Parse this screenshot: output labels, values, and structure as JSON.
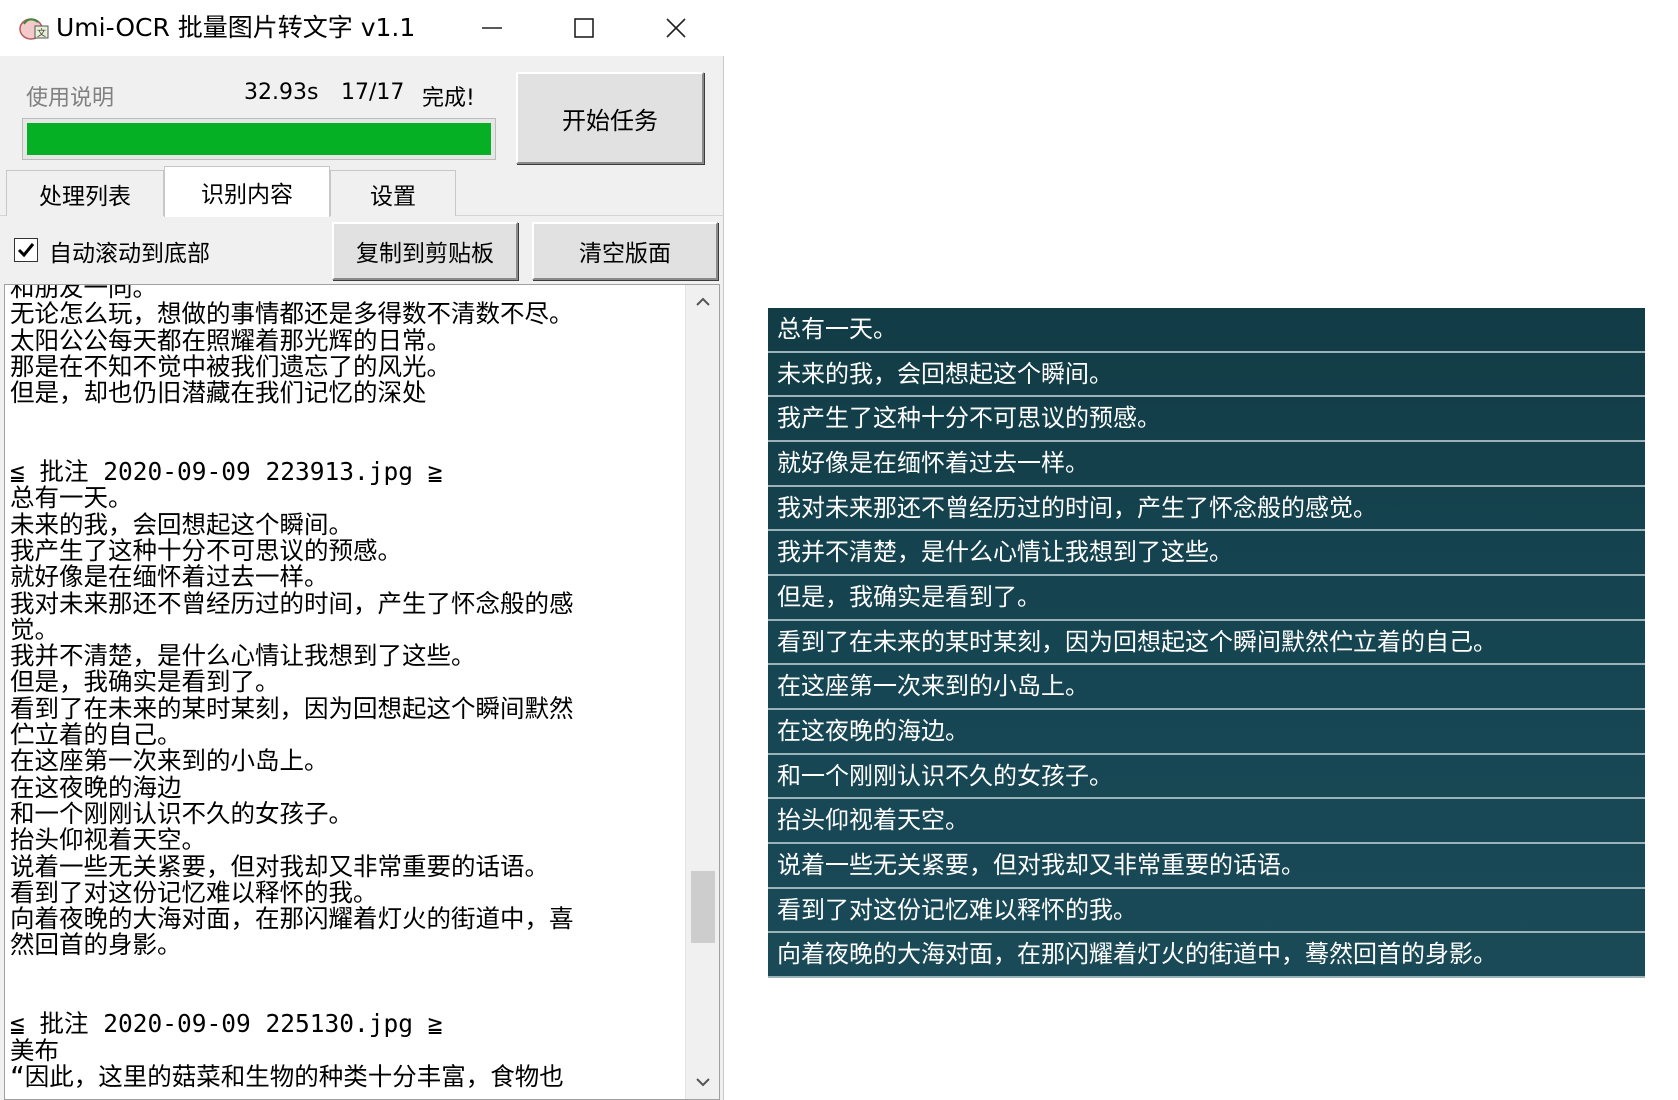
{
  "window": {
    "title": "Umi-OCR 批量图片转文字 v1.1",
    "controls": {
      "minimize": "—",
      "maximize": "☐",
      "close": "✕"
    }
  },
  "status": {
    "help_label": "使用说明",
    "elapsed": "32.93s",
    "count": "17/17",
    "state": "完成!",
    "progress": 1.0,
    "progress_color": "#06b025"
  },
  "start_button": "开始任务",
  "tabs": [
    {
      "label": "处理列表",
      "active": false
    },
    {
      "label": "识别内容",
      "active": true
    },
    {
      "label": "设置",
      "active": false
    }
  ],
  "toolbar": {
    "auto_scroll_label": "自动滚动到底部",
    "auto_scroll_checked": true,
    "copy_label": "复制到剪贴板",
    "clear_label": "清空版面"
  },
  "output_lines": [
    "和朋友一同。",
    "无论怎么玩，想做的事情都还是多得数不清数不尽。",
    "太阳公公每天都在照耀着那光辉的日常。",
    "那是在不知不觉中被我们遗忘了的风光。",
    "但是，却也仍旧潜藏在我们记忆的深处",
    "",
    "",
    "≦ 批注 2020-09-09 223913.jpg ≧",
    "总有一天。",
    "未来的我，会回想起这个瞬间。",
    "我产生了这种十分不可思议的预感。",
    "就好像是在缅怀着过去一样。",
    "我对未来那还不曾经历过的时间，产生了怀念般的感",
    "觉。",
    "我并不清楚，是什么心情让我想到了这些。",
    "但是，我确实是看到了。",
    "看到了在未来的某时某刻，因为回想起这个瞬间默然",
    "伫立着的自己。",
    "在这座第一次来到的小岛上。",
    "在这夜晚的海边",
    "和一个刚刚认识不久的女孩子。",
    "抬头仰视着天空。",
    "说着一些无关紧要，但对我却又非常重要的话语。",
    "看到了对这份记忆难以释怀的我。",
    "向着夜晚的大海对面，在那闪耀着灯火的街道中，喜",
    "然回首的身影。",
    "",
    "",
    "≦ 批注 2020-09-09 225130.jpg ≧",
    "美布",
    "“因此，这里的菇菜和生物的种类十分丰富，食物也"
  ],
  "game_subtitles": [
    "总有一天。",
    "未来的我，会回想起这个瞬间。",
    "我产生了这种十分不可思议的预感。",
    "就好像是在缅怀着过去一样。",
    "我对未来那还不曾经历过的时间，产生了怀念般的感觉。",
    "我并不清楚，是什么心情让我想到了这些。",
    "但是，我确实是看到了。",
    "看到了在未来的某时某刻，因为回想起这个瞬间默然伫立着的自己。",
    "在这座第一次来到的小岛上。",
    "在这夜晚的海边。",
    "和一个刚刚认识不久的女孩子。",
    "抬头仰视着天空。",
    "说着一些无关紧要，但对我却又非常重要的话语。",
    "看到了对这份记忆难以释怀的我。",
    "向着夜晚的大海对面，在那闪耀着灯火的街道中，蓦然回首的身影。"
  ]
}
